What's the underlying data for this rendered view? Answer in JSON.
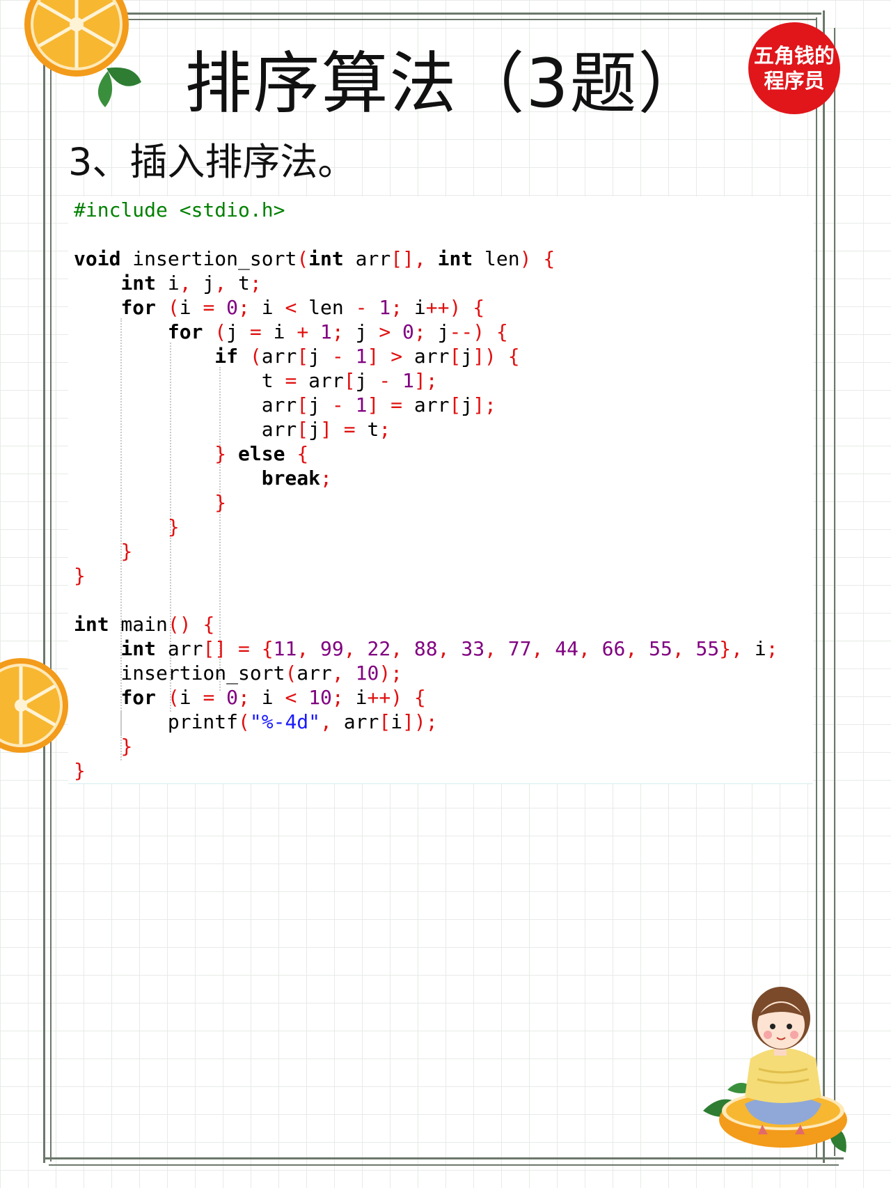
{
  "header": {
    "title": "排序算法（3题）",
    "badge_line1": "五角钱的",
    "badge_line2": "程序员"
  },
  "section": {
    "heading": "3、插入排序法。"
  },
  "code": {
    "include": "#include <stdio.h>",
    "arr_values": [
      "11",
      "99",
      "22",
      "88",
      "33",
      "77",
      "44",
      "66",
      "55",
      "55"
    ],
    "format_string": "\"%-4d\"",
    "loop_bound": "10"
  },
  "colors": {
    "keyword": "#000000",
    "preprocessor": "#008000",
    "operator": "#e01010",
    "number": "#800080",
    "string": "#1a1aff",
    "badge": "#e0161b",
    "frame": "#6b786b"
  },
  "decorations": [
    "orange-slice-icon",
    "leaf-icon",
    "girl-sitting-on-orange-illustration"
  ]
}
